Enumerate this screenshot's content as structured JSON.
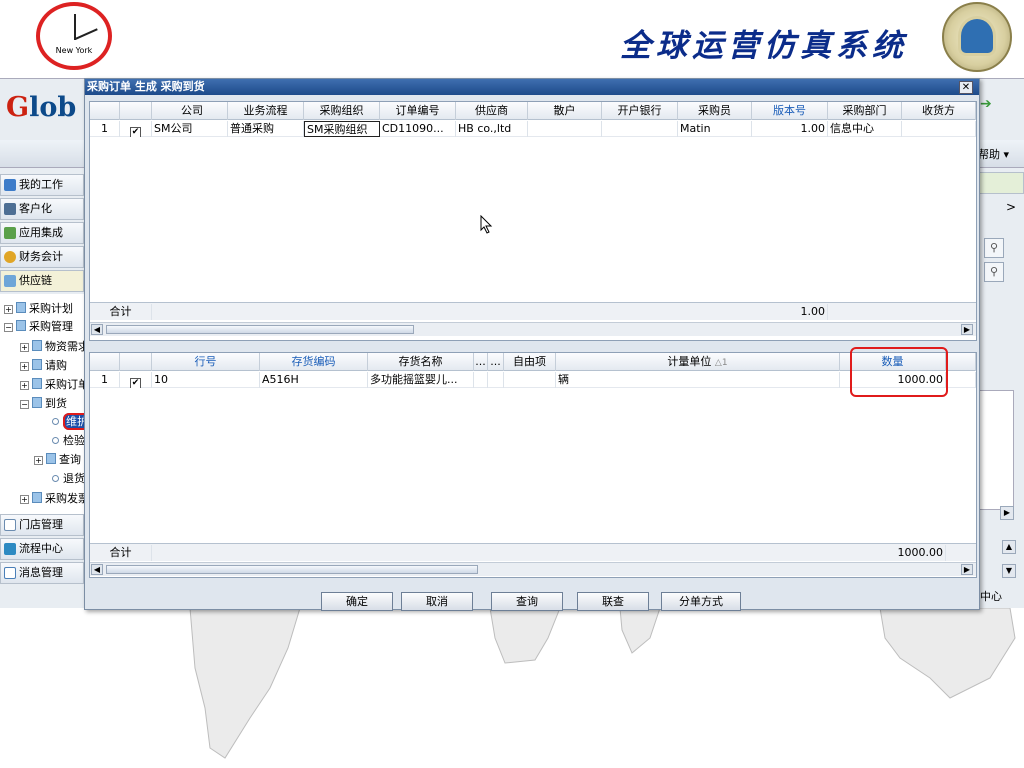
{
  "header": {
    "clock_city": "New York",
    "brand_title": "全球运营仿真系统"
  },
  "app": {
    "logo_g": "G",
    "logo_rest": "lob",
    "help_menu": "帮助 ▾",
    "nav_items": [
      "我的工作",
      "客户化",
      "应用集成",
      "财务会计",
      "供应链"
    ],
    "tree_items": [
      {
        "label": "采购计划",
        "kind": "folder",
        "sign": "+"
      },
      {
        "label": "采购管理",
        "kind": "folder",
        "sign": "−"
      },
      {
        "label": "物资需求",
        "kind": "folder",
        "sign": "+"
      },
      {
        "label": "请购",
        "kind": "folder",
        "sign": "+"
      },
      {
        "label": "采购订单",
        "kind": "folder",
        "sign": "+"
      },
      {
        "label": "到货",
        "kind": "folder",
        "sign": "−"
      },
      {
        "label": "维护",
        "kind": "leaf",
        "sign": ""
      },
      {
        "label": "检验",
        "kind": "leaf",
        "sign": ""
      },
      {
        "label": "查询",
        "kind": "folder",
        "sign": "+"
      },
      {
        "label": "退货",
        "kind": "leaf",
        "sign": ""
      },
      {
        "label": "采购发票",
        "kind": "folder",
        "sign": "+"
      }
    ],
    "bottom_nav": [
      "门店管理",
      "流程中心",
      "消息管理"
    ],
    "right_label": "中心"
  },
  "dialog": {
    "title": "采购订单  生成  采购到货",
    "close": "✕",
    "top_grid": {
      "columns": [
        "",
        "",
        "公司",
        "业务流程",
        "采购组织",
        "订单编号",
        "供应商",
        "散户",
        "开户银行",
        "采购员",
        "版本号",
        "采购部门",
        "收货方"
      ],
      "row": [
        "1",
        "✔",
        "SM公司",
        "普通采购",
        "SM采购组织",
        "CD11090...",
        "HB co.,ltd",
        "",
        "",
        "Matin",
        "1.00",
        "信息中心",
        ""
      ],
      "sum_label": "合计",
      "sum_value": "1.00"
    },
    "bottom_grid": {
      "columns": [
        "",
        "",
        "行号",
        "存货编码",
        "存货名称",
        "...",
        "...",
        "自由项",
        "计量单位",
        "数量",
        ""
      ],
      "sort_marker": "△1",
      "row": [
        "1",
        "✔",
        "10",
        "A516H",
        "多功能摇篮婴儿...",
        "",
        "",
        "",
        "辆",
        "1000.00",
        ""
      ],
      "sum_label": "合计",
      "sum_value": "1000.00"
    },
    "buttons": [
      "确定",
      "取消",
      "查询",
      "联查",
      "分单方式"
    ]
  }
}
